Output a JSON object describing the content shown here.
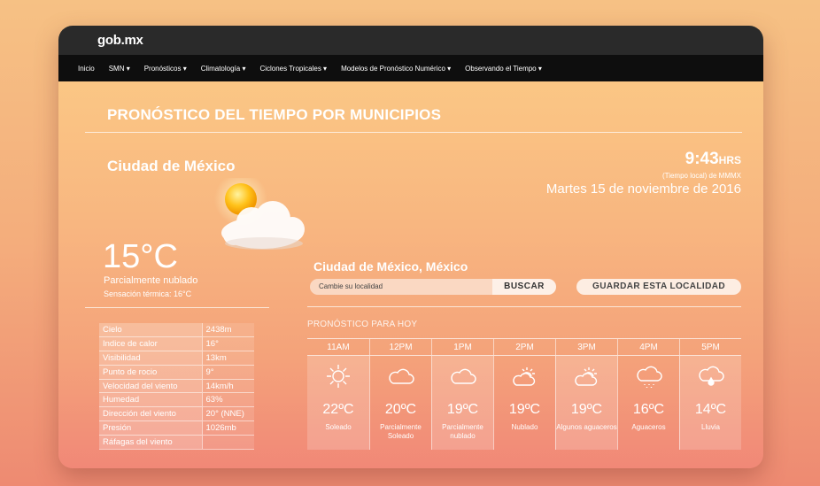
{
  "header": {
    "logo": "gob.mx"
  },
  "nav": [
    "Inicio",
    "SMN ▾",
    "Pronósticos ▾",
    "Climatología ▾",
    "Ciclones Tropicales ▾",
    "Modelos de Pronóstico Numérico ▾",
    "Observando el Tiempo ▾"
  ],
  "page": {
    "title": "PRONÓSTICO DEL TIEMPO POR MUNICIPIOS"
  },
  "current": {
    "city": "Ciudad de México",
    "time": "9:43",
    "time_unit": "HRS",
    "timezone": "(Tiempo local) de MMMX",
    "date": "Martes 15 de noviembre de 2016",
    "temperature": "15°C",
    "condition": "Parcialmente nublado",
    "feels_like": "Sensación térmica: 16°C"
  },
  "stats": [
    {
      "label": "Cielo",
      "value": "2438m"
    },
    {
      "label": "Indice de calor",
      "value": "16°"
    },
    {
      "label": "Visibilidad",
      "value": "13km"
    },
    {
      "label": "Punto de rocio",
      "value": "9°"
    },
    {
      "label": "Velocidad del viento",
      "value": "14km/h"
    },
    {
      "label": "Humedad",
      "value": "63%"
    },
    {
      "label": "Dirección del viento",
      "value": "20° (NNE)"
    },
    {
      "label": "Presión",
      "value": "1026mb"
    },
    {
      "label": "Ráfagas del viento",
      "value": ""
    }
  ],
  "location": {
    "name": "Ciudad de México, México",
    "placeholder": "Cambie su localidad",
    "search_label": "BUSCAR",
    "save_label": "GUARDAR ESTA LOCALIDAD"
  },
  "forecast": {
    "title": "PRONÓSTICO PARA HOY",
    "hours": [
      {
        "hour": "11AM",
        "temp": "22ºC",
        "cond": "Soleado",
        "icon": "sun-icon"
      },
      {
        "hour": "12PM",
        "temp": "20ºC",
        "cond": "Parcialmente Soleado",
        "icon": "cloud-icon"
      },
      {
        "hour": "1PM",
        "temp": "19ºC",
        "cond": "Parcialmente nublado",
        "icon": "cloud-icon"
      },
      {
        "hour": "2PM",
        "temp": "19ºC",
        "cond": "Nublado",
        "icon": "sun-cloud-icon"
      },
      {
        "hour": "3PM",
        "temp": "19ºC",
        "cond": "Algunos aguaceros",
        "icon": "sun-cloud-icon"
      },
      {
        "hour": "4PM",
        "temp": "16ºC",
        "cond": "Aguaceros",
        "icon": "rain-cloud-icon"
      },
      {
        "hour": "5PM",
        "temp": "14ºC",
        "cond": "Lluvia",
        "icon": "drop-cloud-icon"
      }
    ]
  }
}
